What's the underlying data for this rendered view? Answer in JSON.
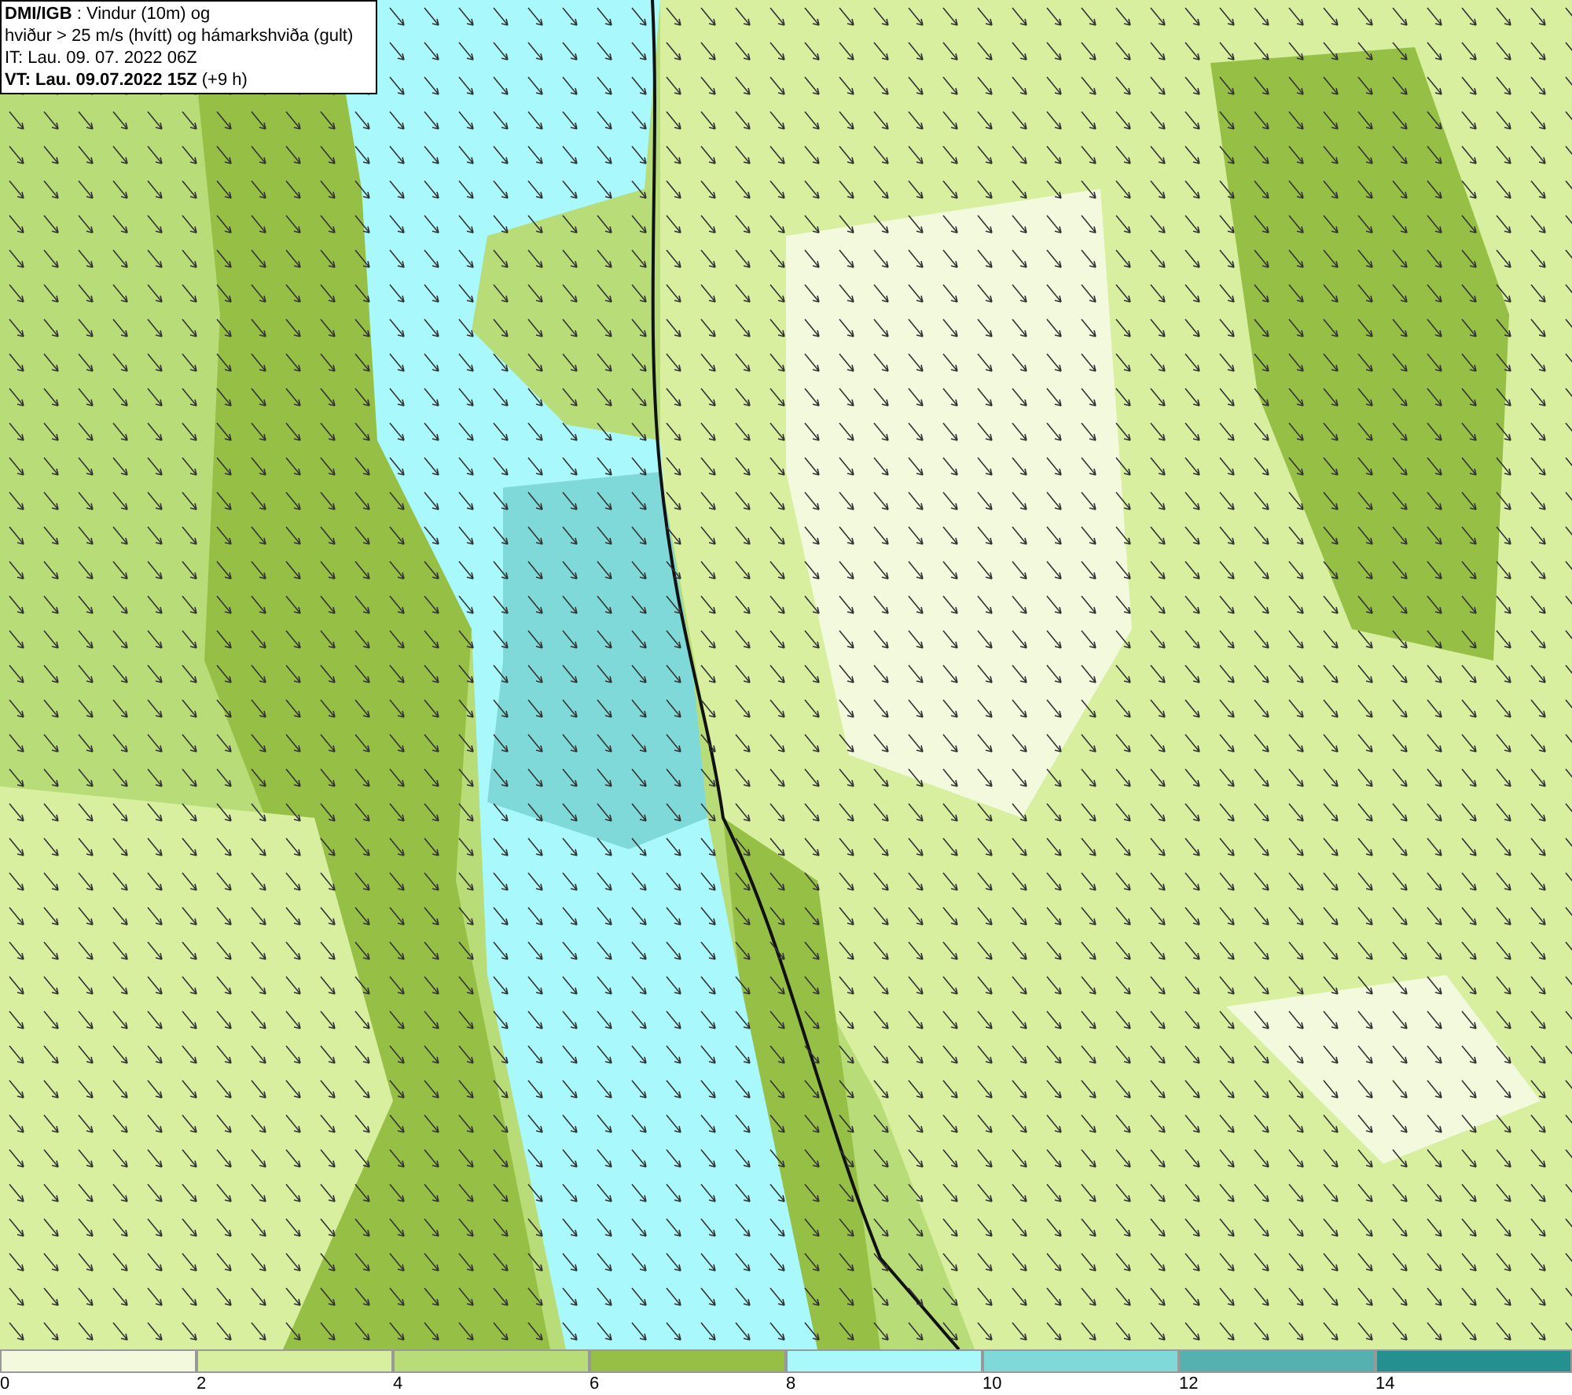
{
  "header": [
    "**DMI/IGB** : Vindur (10m) og",
    "hviður > 25 m/s (hvítt) og hámarkshviða (gult)",
    "IT: Lau. 09. 07. 2022 06Z",
    "**VT: Lau. 09.07.2022 15Z** (+9 h)"
  ],
  "colorbar": [
    {
      "color": "#f2f9dc",
      "label": "0"
    },
    {
      "color": "#d7ef9f",
      "label": "2"
    },
    {
      "color": "#b8dc78",
      "label": "4"
    },
    {
      "color": "#96bf46",
      "label": "6"
    },
    {
      "color": "#a8f8fc",
      "label": "8"
    },
    {
      "color": "#80d9d9",
      "label": "10"
    },
    {
      "color": "#55b0b0",
      "label": "12"
    },
    {
      "color": "#259090",
      "label": "14"
    }
  ]
}
